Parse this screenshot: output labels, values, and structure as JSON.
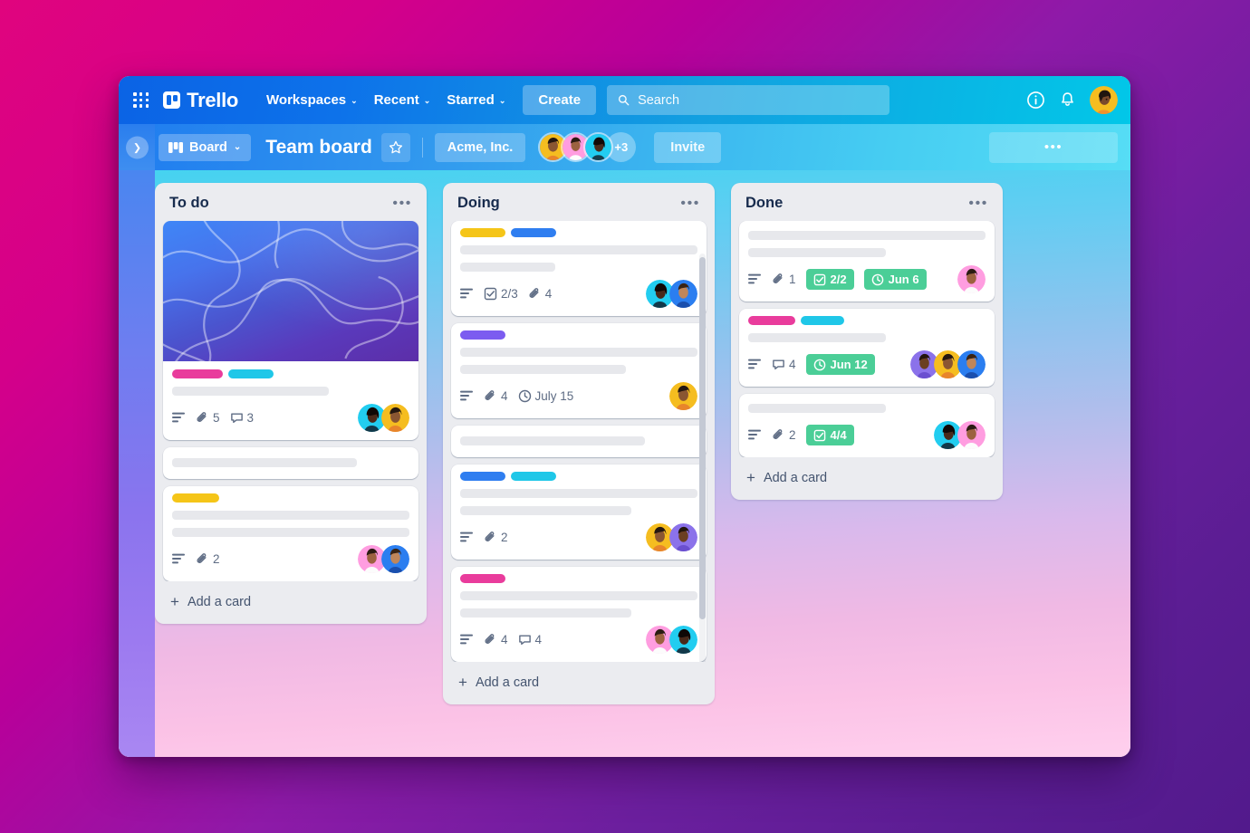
{
  "topnav": {
    "apps_icon": "apps-grid-icon",
    "brand": "Trello",
    "items": [
      {
        "label": "Workspaces",
        "caret": "⌄"
      },
      {
        "label": "Recent",
        "caret": "⌄"
      },
      {
        "label": "Starred",
        "caret": "⌄"
      }
    ],
    "create_label": "Create",
    "search_placeholder": "Search",
    "info_icon": "info-circle-icon",
    "bell_icon": "notification-bell-icon",
    "avatar_icon": "user-avatar"
  },
  "boardbar": {
    "toggle_icon": "chevron-right-icon",
    "view_label": "Board",
    "view_caret": "⌄",
    "board_title": "Team board",
    "star_icon": "star-outline-icon",
    "workspace": "Acme, Inc.",
    "member_overflow": "+3",
    "invite_label": "Invite",
    "more_label": "•••"
  },
  "colors": {
    "label_pink": "#e93c9c",
    "label_cyan": "#1fc7e8",
    "label_yellow": "#f5c518",
    "label_blue": "#2f7ef0",
    "label_purple": "#7c5cf0",
    "badge_green": "#4bce97"
  },
  "lists": [
    {
      "title": "To do",
      "menu": "•••",
      "add_card": "Add a card",
      "scroll": false,
      "cards": [
        {
          "cover": true,
          "labels": [
            "#e93c9c",
            "#1fc7e8"
          ],
          "lines": [
            "w66"
          ],
          "badges": [
            {
              "type": "description",
              "icon": "description-icon"
            },
            {
              "type": "attachment",
              "icon": "attachment-icon",
              "value": "5"
            },
            {
              "type": "comment",
              "icon": "comment-icon",
              "value": "3"
            }
          ],
          "avatars": [
            "#22cdf0",
            "#f5bd20"
          ]
        },
        {
          "cover": false,
          "labels": [],
          "lines": [
            "w78"
          ],
          "badges": [],
          "avatars": []
        },
        {
          "cover": false,
          "labels": [
            "#f5c518"
          ],
          "lines": [
            "w100",
            "w72"
          ],
          "badges": [
            {
              "type": "description",
              "icon": "description-icon"
            },
            {
              "type": "attachment",
              "icon": "attachment-icon",
              "value": "2"
            }
          ],
          "avatars": [
            "#ff9de0",
            "#2b7ef0"
          ]
        }
      ]
    },
    {
      "title": "Doing",
      "menu": "•••",
      "add_card": "Add a card",
      "scroll": true,
      "cards": [
        {
          "cover": false,
          "labels": [
            "#f5c518",
            "#2f7ef0"
          ],
          "lines": [
            "w100",
            "w52"
          ],
          "badges": [
            {
              "type": "description",
              "icon": "description-icon"
            },
            {
              "type": "checklist",
              "icon": "checklist-icon",
              "value": "2/3"
            },
            {
              "type": "attachment",
              "icon": "attachment-icon",
              "value": "4"
            }
          ],
          "avatars": [
            "#22cdf0",
            "#2b7ef0"
          ]
        },
        {
          "cover": false,
          "labels": [
            "#7c5cf0"
          ],
          "lines": [
            "w100",
            "w70"
          ],
          "badges": [
            {
              "type": "description",
              "icon": "description-icon"
            },
            {
              "type": "attachment",
              "icon": "attachment-icon",
              "value": "4"
            },
            {
              "type": "due",
              "icon": "clock-icon",
              "value": "July 15"
            }
          ],
          "avatars": [
            "#f5bd20"
          ]
        },
        {
          "cover": false,
          "labels": [],
          "lines": [
            "w78"
          ],
          "badges": [],
          "avatars": []
        },
        {
          "cover": false,
          "labels": [
            "#2f7ef0",
            "#1fc7e8"
          ],
          "lines": [
            "w100",
            "w72"
          ],
          "badges": [
            {
              "type": "description",
              "icon": "description-icon"
            },
            {
              "type": "attachment",
              "icon": "attachment-icon",
              "value": "2"
            }
          ],
          "avatars": [
            "#f5bd20",
            "#8b72ea"
          ]
        },
        {
          "cover": false,
          "labels": [
            "#e93c9c"
          ],
          "lines": [
            "w100",
            "w72"
          ],
          "badges": [
            {
              "type": "description",
              "icon": "description-icon"
            },
            {
              "type": "attachment",
              "icon": "attachment-icon",
              "value": "4"
            },
            {
              "type": "comment",
              "icon": "comment-icon",
              "value": "4"
            }
          ],
          "avatars": [
            "#ff9de0",
            "#22cdf0"
          ]
        }
      ]
    },
    {
      "title": "Done",
      "menu": "•••",
      "add_card": "Add a card",
      "scroll": false,
      "cards": [
        {
          "cover": false,
          "labels": [],
          "lines": [
            "w100",
            "w58"
          ],
          "badges": [
            {
              "type": "description",
              "icon": "description-icon"
            },
            {
              "type": "attachment",
              "icon": "attachment-icon",
              "value": "1"
            },
            {
              "type": "checklist-green",
              "icon": "checklist-icon",
              "value": "2/2"
            },
            {
              "type": "due-green",
              "icon": "clock-icon",
              "value": "Jun 6"
            }
          ],
          "avatars": [
            "#ff9de0"
          ]
        },
        {
          "cover": false,
          "labels": [
            "#e93c9c",
            "#1fc7e8"
          ],
          "lines": [
            "w58"
          ],
          "badges": [
            {
              "type": "description",
              "icon": "description-icon"
            },
            {
              "type": "comment",
              "icon": "comment-icon",
              "value": "4"
            },
            {
              "type": "due-green",
              "icon": "clock-icon",
              "value": "Jun 12"
            }
          ],
          "avatars": [
            "#8b72ea",
            "#f5bd20",
            "#2b7ef0"
          ]
        },
        {
          "cover": false,
          "labels": [],
          "lines": [
            "w58"
          ],
          "badges": [
            {
              "type": "description",
              "icon": "description-icon"
            },
            {
              "type": "attachment",
              "icon": "attachment-icon",
              "value": "2"
            },
            {
              "type": "checklist-green",
              "icon": "checklist-icon",
              "value": "4/4"
            }
          ],
          "avatars": [
            "#22cdf0",
            "#ff9de0"
          ]
        }
      ]
    }
  ]
}
